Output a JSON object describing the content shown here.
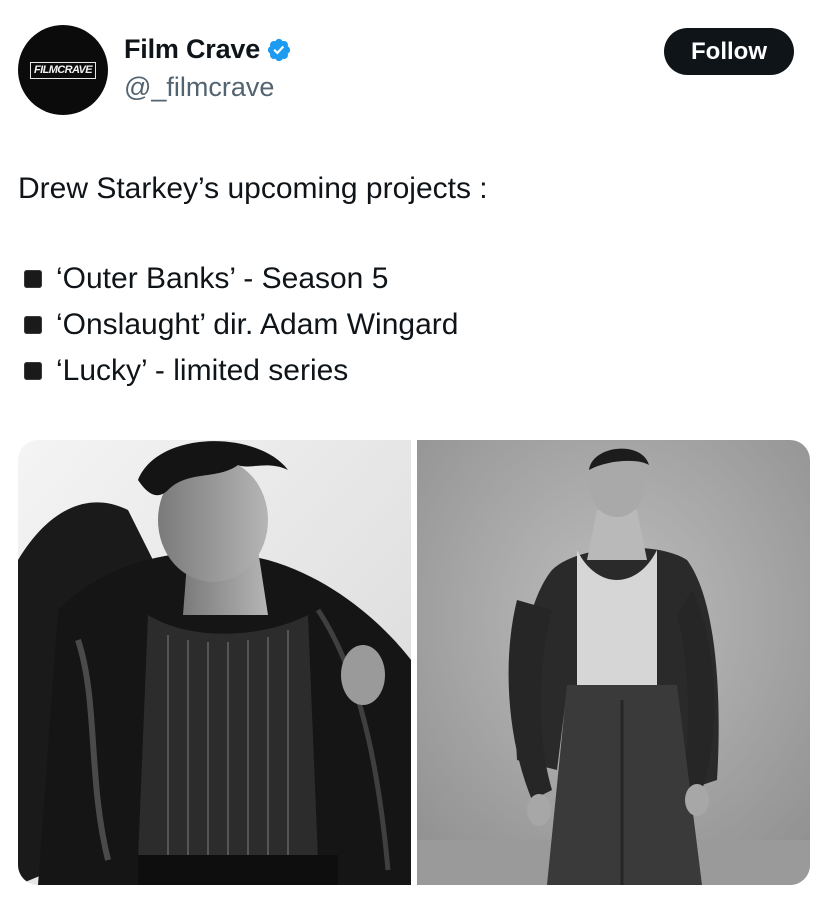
{
  "account": {
    "display_name": "Film Crave",
    "handle": "@_filmcrave",
    "avatar_text": "FILMCRAVE",
    "verified": true
  },
  "actions": {
    "follow_label": "Follow"
  },
  "tweet": {
    "headline": "Drew Starkey’s upcoming projects :",
    "items": [
      "‘Outer Banks’ - Season 5",
      "‘Onslaught’ dir. Adam Wingard",
      "‘Lucky’ - limited series"
    ]
  },
  "media": {
    "photos": [
      {
        "icon": "photo-leather-jacket"
      },
      {
        "icon": "photo-cardigan"
      }
    ]
  },
  "colors": {
    "text": "#0f1419",
    "secondary": "#536471",
    "verified": "#1d9bf0",
    "button": "#0f1419"
  }
}
